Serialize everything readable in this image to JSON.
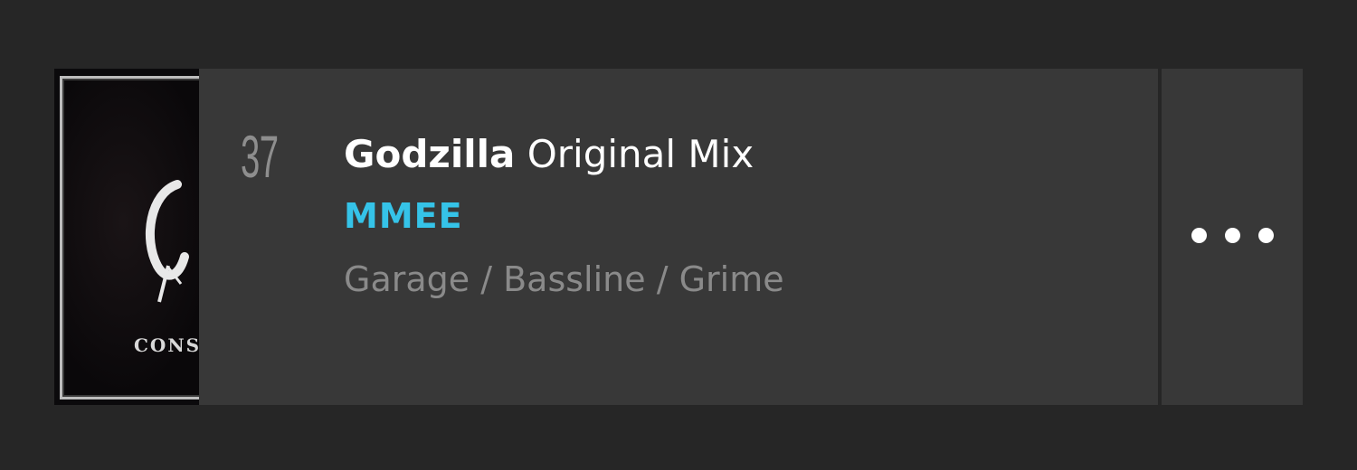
{
  "track": {
    "number": "37",
    "title": "Godzilla",
    "mix": "Original Mix",
    "artist": "MMEE",
    "genre": "Garage / Bassline / Grime",
    "artwork_text": "CONS"
  },
  "icons": {
    "more": "more-horizontal-icon"
  },
  "colors": {
    "background": "#262626",
    "panel": "#383838",
    "artist": "#35c3e8",
    "title": "#ffffff",
    "secondary": "#8a8a8a"
  }
}
